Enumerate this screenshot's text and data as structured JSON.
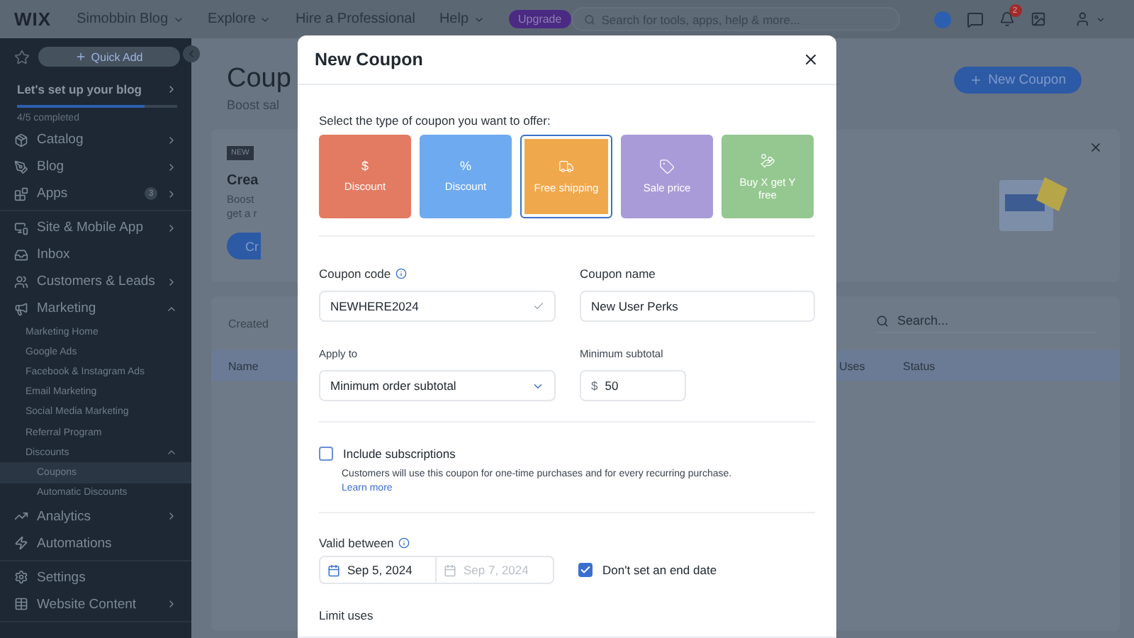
{
  "topbar": {
    "logo": "WIX",
    "menus": [
      {
        "label": "Simobbin Blog",
        "dropdown": true
      },
      {
        "label": "Explore",
        "dropdown": true
      },
      {
        "label": "Hire a Professional",
        "dropdown": false
      },
      {
        "label": "Help",
        "dropdown": true
      }
    ],
    "upgrade": "Upgrade",
    "search": {
      "placeholder": "Search for tools, apps, help & more..."
    },
    "notifications": "2"
  },
  "sidebar": {
    "quick_add": "Quick Add",
    "setup": {
      "title": "Let's set up your blog",
      "level": 0.8,
      "progress": "4/5 completed"
    },
    "groups": [
      [
        {
          "label": "Catalog",
          "expanded": false,
          "selected": false
        },
        {
          "label": "Blog",
          "expanded": false,
          "selected": false
        },
        {
          "label": "Apps",
          "badge": "3",
          "expanded": false,
          "selected": false
        }
      ],
      [
        {
          "label": "Site & Mobile App",
          "expanded": false,
          "selected": false
        },
        {
          "label": "Inbox",
          "selected": false
        },
        {
          "label": "Customers & Leads",
          "expanded": false,
          "selected": false
        },
        {
          "label": "Marketing",
          "expanded": true,
          "selected": false,
          "children": [
            {
              "label": "Marketing Home",
              "selected": false
            },
            {
              "label": "Google Ads",
              "selected": false
            },
            {
              "label": "Facebook & Instagram Ads",
              "selected": false
            },
            {
              "label": "Email Marketing",
              "selected": false
            },
            {
              "label": "Social Media Marketing",
              "selected": false
            },
            {
              "label": "Referral Program",
              "selected": false
            },
            {
              "label": "Discounts",
              "expanded": true,
              "selected": false,
              "children": [
                {
                  "label": "Coupons",
                  "selected": true
                },
                {
                  "label": "Automatic Discounts",
                  "selected": false
                }
              ]
            }
          ]
        },
        {
          "label": "Analytics",
          "expanded": false,
          "selected": false
        },
        {
          "label": "Automations",
          "selected": false
        }
      ],
      [
        {
          "label": "Settings",
          "selected": false
        },
        {
          "label": "Website Content",
          "expanded": false,
          "selected": false
        }
      ]
    ]
  },
  "main": {
    "title": "Coup",
    "subtitle": "Boost sal",
    "new_button": "New Coupon",
    "banner": {
      "badge": "NEW",
      "title": "Crea",
      "lines": [
        "Boost",
        "get a r"
      ],
      "button": "Cr"
    },
    "table": {
      "label": "Created",
      "search": {
        "placeholder": "Search..."
      },
      "columns": [
        "Name",
        "Uses",
        "Status"
      ]
    }
  },
  "modal": {
    "title": "New Coupon",
    "prompt": "Select the type of coupon you want to offer:",
    "types": [
      {
        "kind": "symbol",
        "symbol": "$",
        "label": "Discount",
        "color": "#e27b62",
        "selected": false
      },
      {
        "kind": "symbol",
        "symbol": "%",
        "label": "Discount",
        "color": "#6eaaf0",
        "selected": false
      },
      {
        "kind": "shipping",
        "label": "Free shipping",
        "color": "#f0a84c",
        "selected": true
      },
      {
        "kind": "sale",
        "label": "Sale price",
        "color": "#a99bd8",
        "selected": false
      },
      {
        "kind": "bundle",
        "label": "Buy X get Y free",
        "color": "#95c890",
        "selected": false
      }
    ],
    "coupon_code": {
      "label": "Coupon code",
      "value": "NEWHERE2024"
    },
    "coupon_name": {
      "label": "Coupon name",
      "value": "New User Perks"
    },
    "apply_to": {
      "label": "Apply to",
      "value": "Minimum order subtotal"
    },
    "minimum_subtotal": {
      "label": "Minimum subtotal",
      "currency": "$",
      "value": "50"
    },
    "subscriptions": {
      "label": "Include subscriptions",
      "checked": false,
      "description": "Customers will use this coupon for one-time purchases and for every recurring purchase.",
      "link": "Learn more"
    },
    "valid_between": {
      "label": "Valid between",
      "start": "Sep 5, 2024",
      "end": "Sep 7, 2024"
    },
    "no_end_date": {
      "label": "Don't set an end date",
      "checked": true
    },
    "limit_uses": {
      "label": "Limit uses"
    }
  }
}
